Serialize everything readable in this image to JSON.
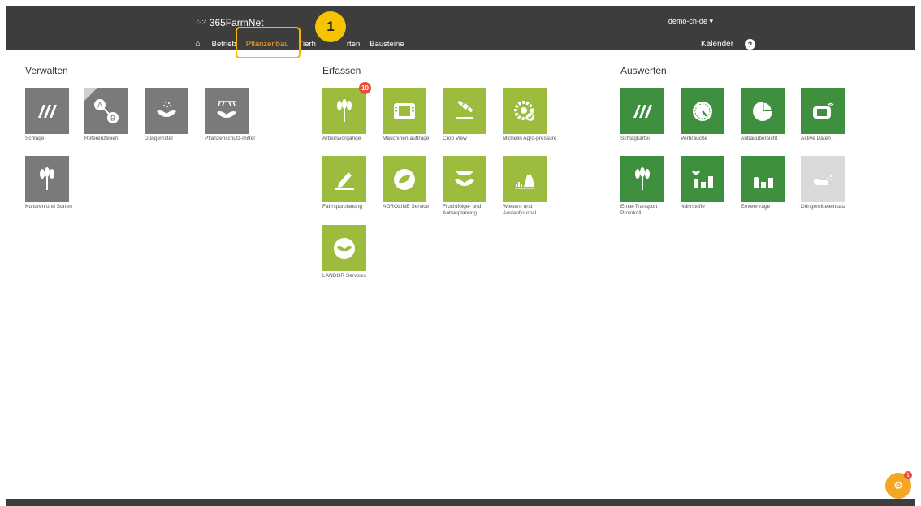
{
  "header": {
    "logo": "365FarmNet",
    "user": "demo-ch-de",
    "nav": [
      "Betrieb",
      "Pflanzenbau",
      "Tierh",
      "rten",
      "Bausteine"
    ],
    "calendar": "Kalender",
    "help": "?",
    "step": "1"
  },
  "sections": {
    "verwalten": "Verwalten",
    "erfassen": "Erfassen",
    "auswerten": "Auswerten"
  },
  "tiles": {
    "schlaege": "Schläge",
    "referenzlinien": "Referenzlinien",
    "duengemittel": "Düngemittel",
    "pflanzenschutz": "Pflanzenschutz-mittel",
    "kulturen": "Kulturen und Sorten",
    "arbeitsvorgaenge": "Arbeitsvorgänge",
    "arbeitsvorgaenge_badge": "10",
    "maschinen": "Maschinen-aufträge",
    "cropview": "Crop View",
    "michelin": "Michelin Agro-pressure",
    "fahrspur": "Fahrspurplanung",
    "agroline": "AGROLINE Service",
    "fruchtfolge": "Fruchtfolge- und Anbauplanung",
    "wiesen": "Wiesen- und Auslaufjournal",
    "landor": "LANDOR Services",
    "schlagkartei": "Schlagkartei",
    "verbraeuche": "Verbräuche",
    "anbauuebersicht": "Anbauübersicht",
    "activedaten": "Active Daten",
    "ernte": "Ernte-Transport Protokoll",
    "naehrstoffe": "Nährstoffe",
    "ernteertraege": "Ernteerträge",
    "duengemitteleinsatz": "Düngemitteleinsatz"
  },
  "fab": {
    "count": "1"
  }
}
